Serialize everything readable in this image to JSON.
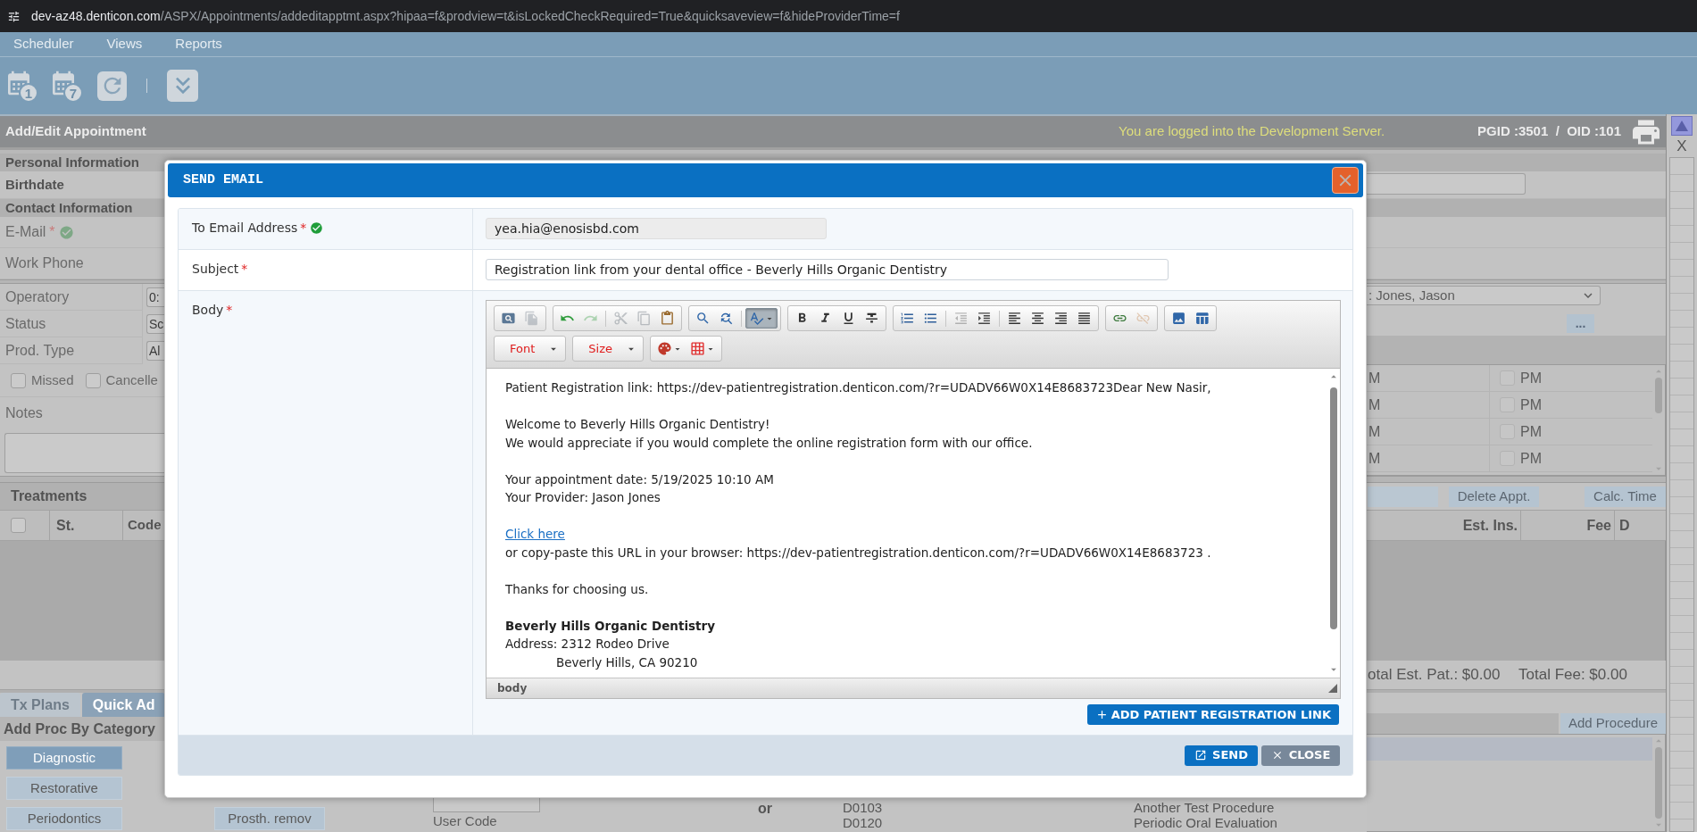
{
  "browser": {
    "host": "dev-az48.denticon.com",
    "path": "/ASPX/Appointments/addeditapptmt.aspx?hipaa=f&prodview=t&isLockedCheckRequired=True&quicksaveview=f&hideProviderTime=f"
  },
  "menu": [
    {
      "label": "Scheduler"
    },
    {
      "label": "Views"
    },
    {
      "label": "Reports"
    }
  ],
  "toolbar": [
    {
      "kind": "calendar",
      "badge": "1"
    },
    {
      "kind": "calendar",
      "badge": "7"
    },
    {
      "kind": "refresh"
    },
    {
      "kind": "separator"
    },
    {
      "kind": "collapse"
    }
  ],
  "header": {
    "title": "Add/Edit Appointment",
    "notice": "You are logged into the Development Server.",
    "ids": "PGID :3501  /  OID :101"
  },
  "side_panel": {
    "close": "X"
  },
  "patient": [
    {
      "kind": "section",
      "label": "Personal Information"
    },
    {
      "kind": "date",
      "label": "Birthdate"
    },
    {
      "kind": "section",
      "label": "Contact Information"
    },
    {
      "kind": "email",
      "label": "E-Mail",
      "required_mark": "*",
      "verified": true
    },
    {
      "kind": "plain",
      "label": "Work Phone"
    }
  ],
  "appointment": {
    "fields": [
      {
        "label": "Operatory",
        "value": "0:"
      },
      {
        "label": "Status",
        "value": "Sc"
      },
      {
        "label": "Prod. Type",
        "value": "Al"
      }
    ],
    "flags": [
      {
        "label": "Missed",
        "checked": false
      },
      {
        "label": "Cancelle",
        "checked": false
      }
    ],
    "notes_label": "Notes",
    "provider": ": Jones, Jason",
    "more_button": "...",
    "time_rows": [
      {
        "column_1": "M",
        "column_2": "PM",
        "checked": false
      },
      {
        "column_1": "M",
        "column_2": "PM",
        "checked": false
      },
      {
        "column_1": "M",
        "column_2": "PM",
        "checked": false
      },
      {
        "column_1": "M",
        "column_2": "PM",
        "checked": false
      }
    ]
  },
  "treatments": {
    "title": "Treatments",
    "all_checked": false,
    "columns": [
      "St.",
      "Code"
    ],
    "right_columns": [
      "Est. Ins.",
      "Fee",
      "D"
    ],
    "buttons": [
      "Delete Appt.",
      "Calc. Time"
    ],
    "totals": [
      "otal Est. Pat.: $0.00",
      "Total Fee: $0.00"
    ]
  },
  "procedures": {
    "tabs": [
      {
        "label": "Tx Plans",
        "selected": false
      },
      {
        "label": "Quick Ad",
        "selected": true
      }
    ],
    "category_label": "Add Proc By Category",
    "categories": [
      {
        "label": "Diagnostic",
        "selected": true
      },
      {
        "label": "Restorative",
        "selected": false
      },
      {
        "label": "Periodontics",
        "selected": false
      }
    ],
    "more_categories": [
      {
        "label": "Prosth. remov",
        "selected": false
      }
    ],
    "user_code_label": "User Code",
    "or_label": "or",
    "add_button": "Add Procedure",
    "list": [
      {
        "code": "D0103",
        "description": "Another Test Procedure"
      },
      {
        "code": "D0120",
        "description": "Periodic Oral Evaluation"
      }
    ]
  },
  "dialog": {
    "title": "SEND EMAIL",
    "fields": [
      {
        "kind": "readonly",
        "label": "To Email Address",
        "required_mark": "*",
        "verified": true,
        "value": "yea.hia@enosisbd.com"
      },
      {
        "kind": "input",
        "label": "Subject",
        "required_mark": "*",
        "verified": false,
        "value": "Registration link from your dental office - Beverly Hills Organic Dentistry"
      },
      {
        "kind": "editor",
        "label": "Body",
        "required_mark": "*",
        "verified": false
      }
    ],
    "editor": {
      "toolbar": [
        {
          "groups": [
            {
              "items": [
                {
                  "kind": "preview",
                  "disabled": false,
                  "pressed": false
                },
                {
                  "kind": "templates",
                  "disabled": true,
                  "pressed": false
                }
              ]
            },
            {
              "items": [
                {
                  "kind": "undo",
                  "disabled": false,
                  "pressed": false
                },
                {
                  "kind": "redo",
                  "disabled": true,
                  "pressed": false
                },
                {
                  "kind": "separator"
                },
                {
                  "kind": "cut",
                  "disabled": true,
                  "pressed": false
                },
                {
                  "kind": "copy",
                  "disabled": true,
                  "pressed": false
                },
                {
                  "kind": "paste",
                  "disabled": false,
                  "pressed": false
                }
              ]
            },
            {
              "items": [
                {
                  "kind": "find",
                  "disabled": false,
                  "pressed": false
                },
                {
                  "kind": "replace",
                  "disabled": false,
                  "pressed": false
                },
                {
                  "kind": "separator"
                },
                {
                  "kind": "spellcheck",
                  "disabled": false,
                  "pressed": true
                }
              ]
            },
            {
              "items": [
                {
                  "kind": "bold",
                  "disabled": false,
                  "pressed": false
                },
                {
                  "kind": "italic",
                  "disabled": false,
                  "pressed": false
                },
                {
                  "kind": "underline",
                  "disabled": false,
                  "pressed": false
                },
                {
                  "kind": "strike",
                  "disabled": false,
                  "pressed": false
                }
              ]
            },
            {
              "items": [
                {
                  "kind": "numbered_list",
                  "disabled": false,
                  "pressed": false
                },
                {
                  "kind": "bulleted_list",
                  "disabled": false,
                  "pressed": false
                },
                {
                  "kind": "separator"
                },
                {
                  "kind": "outdent",
                  "disabled": true,
                  "pressed": false
                },
                {
                  "kind": "indent",
                  "disabled": false,
                  "pressed": false
                },
                {
                  "kind": "separator"
                },
                {
                  "kind": "align_left",
                  "disabled": false,
                  "pressed": false
                },
                {
                  "kind": "align_center",
                  "disabled": false,
                  "pressed": false
                },
                {
                  "kind": "align_right",
                  "disabled": false,
                  "pressed": false
                },
                {
                  "kind": "justify",
                  "disabled": false,
                  "pressed": false
                }
              ]
            },
            {
              "items": [
                {
                  "kind": "link",
                  "disabled": false,
                  "pressed": false
                },
                {
                  "kind": "unlink",
                  "disabled": true,
                  "pressed": false
                }
              ]
            },
            {
              "items": [
                {
                  "kind": "image",
                  "disabled": false,
                  "pressed": false
                },
                {
                  "kind": "table",
                  "disabled": false,
                  "pressed": false
                }
              ]
            }
          ]
        },
        {
          "groups": [
            {
              "items": [
                {
                  "kind": "select",
                  "label": "Font"
                }
              ]
            },
            {
              "items": [
                {
                  "kind": "select",
                  "label": "Size"
                }
              ]
            },
            {
              "items": [
                {
                  "kind": "text_color",
                  "disabled": false,
                  "pressed": false
                },
                {
                  "kind": "background_color",
                  "disabled": false,
                  "pressed": false
                }
              ]
            }
          ]
        }
      ],
      "lines": [
        {
          "kind": "text",
          "text": "Patient Registration link: https://dev-patientregistration.denticon.com/?r=UDADV66W0X14E8683723Dear New Nasir,"
        },
        {
          "kind": "blank"
        },
        {
          "kind": "text",
          "text": "Welcome to Beverly Hills Organic Dentistry!"
        },
        {
          "kind": "text",
          "text": "We would appreciate if you would complete the online registration form with our office."
        },
        {
          "kind": "blank"
        },
        {
          "kind": "text",
          "text": "Your appointment date: 5/19/2025 10:10 AM"
        },
        {
          "kind": "text",
          "text": "Your Provider: Jason Jones"
        },
        {
          "kind": "blank"
        },
        {
          "kind": "link",
          "text": "Click here"
        },
        {
          "kind": "text",
          "text": "or copy-paste this URL in your browser: https://dev-patientregistration.denticon.com/?r=UDADV66W0X14E8683723 ."
        },
        {
          "kind": "blank"
        },
        {
          "kind": "text",
          "text": "Thanks for choosing us."
        },
        {
          "kind": "blank"
        },
        {
          "kind": "bold",
          "text": "Beverly Hills Organic Dentistry"
        },
        {
          "kind": "text",
          "text": "Address: 2312 Rodeo Drive"
        },
        {
          "kind": "indented",
          "text": "Beverly Hills, CA 90210"
        }
      ],
      "status_path": "body"
    },
    "add_link_button": "ADD PATIENT REGISTRATION LINK",
    "buttons": [
      {
        "kind": "send",
        "label": "SEND"
      },
      {
        "kind": "close",
        "label": "CLOSE"
      }
    ]
  }
}
